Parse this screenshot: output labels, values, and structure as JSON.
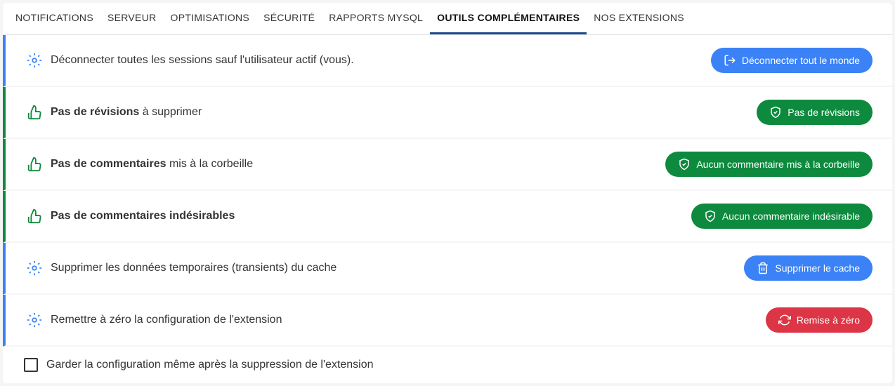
{
  "tabs": {
    "notifications": "Notifications",
    "serveur": "Serveur",
    "optimisations": "Optimisations",
    "securite": "Sécurité",
    "rapports": "Rapports MySQL",
    "outils": "Outils complémentaires",
    "extensions": "Nos extensions"
  },
  "rows": {
    "disconnect": {
      "text": "Déconnecter toutes les sessions sauf l'utilisateur actif (vous).",
      "button": "Déconnecter tout le monde"
    },
    "revisions": {
      "bold": "Pas de révisions",
      "rest": " à supprimer",
      "button": "Pas de révisions"
    },
    "comments_trash": {
      "bold": "Pas de commentaires",
      "rest": " mis à la corbeille",
      "button": "Aucun commentaire mis à la corbeille"
    },
    "comments_spam": {
      "bold": "Pas de commentaires indésirables",
      "button": "Aucun commentaire indésirable"
    },
    "transients": {
      "text": "Supprimer les données temporaires (transients) du cache",
      "button": "Supprimer le cache"
    },
    "reset": {
      "text": "Remettre à zéro la configuration de l'extension",
      "button": "Remise à zéro"
    }
  },
  "footer": {
    "checkbox_label": "Garder la configuration même après la suppression de l'extension"
  }
}
